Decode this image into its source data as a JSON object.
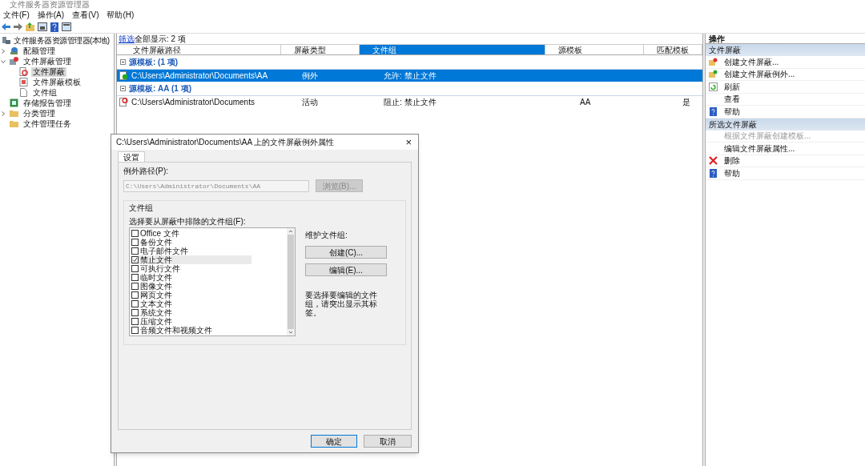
{
  "window": {
    "title": "文件服务器资源管理器"
  },
  "menu": [
    "文件(F)",
    "操作(A)",
    "查看(V)",
    "帮助(H)"
  ],
  "tree": {
    "label": "文件服务器资源管理器(本地)",
    "kind": "server",
    "children": [
      {
        "label": "配额管理",
        "kind": "quota",
        "expanded": false,
        "selected": false
      },
      {
        "label": "文件屏蔽管理",
        "kind": "screen",
        "expanded": true,
        "selected": false,
        "children": [
          {
            "label": "文件屏蔽",
            "kind": "block",
            "selected": true
          },
          {
            "label": "文件屏蔽模板",
            "kind": "template",
            "selected": false
          },
          {
            "label": "文件组",
            "kind": "page",
            "selected": false
          }
        ]
      },
      {
        "label": "存储报告管理",
        "kind": "report",
        "selected": false
      },
      {
        "label": "分类管理",
        "kind": "folder",
        "expanded": false,
        "selected": false
      },
      {
        "label": "文件管理任务",
        "kind": "folder",
        "selected": false
      }
    ]
  },
  "filter": {
    "link": "筛选",
    "text": "全部显示: 2 项"
  },
  "columns": [
    {
      "label": "文件屏蔽路径",
      "selected": false
    },
    {
      "label": "屏蔽类型",
      "selected": false
    },
    {
      "label": "文件组",
      "selected": true
    },
    {
      "label": "源模板",
      "selected": false
    },
    {
      "label": "匹配模板",
      "selected": false
    }
  ],
  "groups": [
    {
      "title": "源模板: (1 项)",
      "rows": [
        {
          "kind": "exception",
          "selected": true,
          "cells": [
            "C:\\Users\\Administrator\\Documents\\AA",
            "例外",
            "允许: 禁止文件",
            "",
            ""
          ]
        }
      ]
    },
    {
      "title": "源模板: AA (1 项)",
      "rows": [
        {
          "kind": "active",
          "selected": false,
          "cells": [
            "C:\\Users\\Administrator\\Documents",
            "活动",
            "阻止: 禁止文件",
            "AA",
            "是"
          ]
        }
      ]
    }
  ],
  "actions": {
    "title": "操作",
    "sections": [
      {
        "title": "文件屏蔽",
        "items": [
          {
            "label": "创建文件屏蔽...",
            "kind": "create",
            "disabled": false
          },
          {
            "label": "创建文件屏蔽例外...",
            "kind": "create-exception",
            "disabled": false
          },
          {
            "label": "刷新",
            "kind": "refresh",
            "disabled": false
          },
          {
            "label": "查看",
            "kind": "plain",
            "disabled": false
          },
          {
            "label": "帮助",
            "kind": "help",
            "disabled": false
          }
        ]
      },
      {
        "title": "所选文件屏蔽",
        "items": [
          {
            "label": "根据文件屏蔽创建模板...",
            "kind": "plain",
            "disabled": true
          },
          {
            "label": "编辑文件屏蔽属性...",
            "kind": "plain",
            "disabled": false
          },
          {
            "label": "删除",
            "kind": "delete",
            "disabled": false
          },
          {
            "label": "帮助",
            "kind": "help",
            "disabled": false
          }
        ]
      }
    ]
  },
  "dialog": {
    "title": "C:\\Users\\Administrator\\Documents\\AA 上的文件屏蔽例外属性",
    "close": "×",
    "tabs": [
      {
        "label": "设置",
        "selected": true
      }
    ],
    "path_label": "例外路径(P):",
    "path_value": "C:\\Users\\Administrator\\Documents\\AA",
    "browse": {
      "label": "浏览(B)...",
      "disabled": true
    },
    "group_title": "文件组",
    "list_label": "选择要从屏蔽中排除的文件组(F):",
    "file_groups": [
      {
        "label": "Office 文件",
        "checked": false,
        "selected": false
      },
      {
        "label": "备份文件",
        "checked": false,
        "selected": false
      },
      {
        "label": "电子邮件文件",
        "checked": false,
        "selected": false
      },
      {
        "label": "禁止文件",
        "checked": true,
        "selected": true
      },
      {
        "label": "可执行文件",
        "checked": false,
        "selected": false
      },
      {
        "label": "临时文件",
        "checked": false,
        "selected": false
      },
      {
        "label": "图像文件",
        "checked": false,
        "selected": false
      },
      {
        "label": "网页文件",
        "checked": false,
        "selected": false
      },
      {
        "label": "文本文件",
        "checked": false,
        "selected": false
      },
      {
        "label": "系统文件",
        "checked": false,
        "selected": false
      },
      {
        "label": "压缩文件",
        "checked": false,
        "selected": false
      },
      {
        "label": "音频文件和视频文件",
        "checked": false,
        "selected": false
      }
    ],
    "maintain_label": "维护文件组:",
    "buttons": [
      "创建(C)...",
      "编辑(E)..."
    ],
    "hint": "要选择要编辑的文件组，请突出显示其标签。",
    "ok": "确定",
    "cancel": "取消"
  }
}
